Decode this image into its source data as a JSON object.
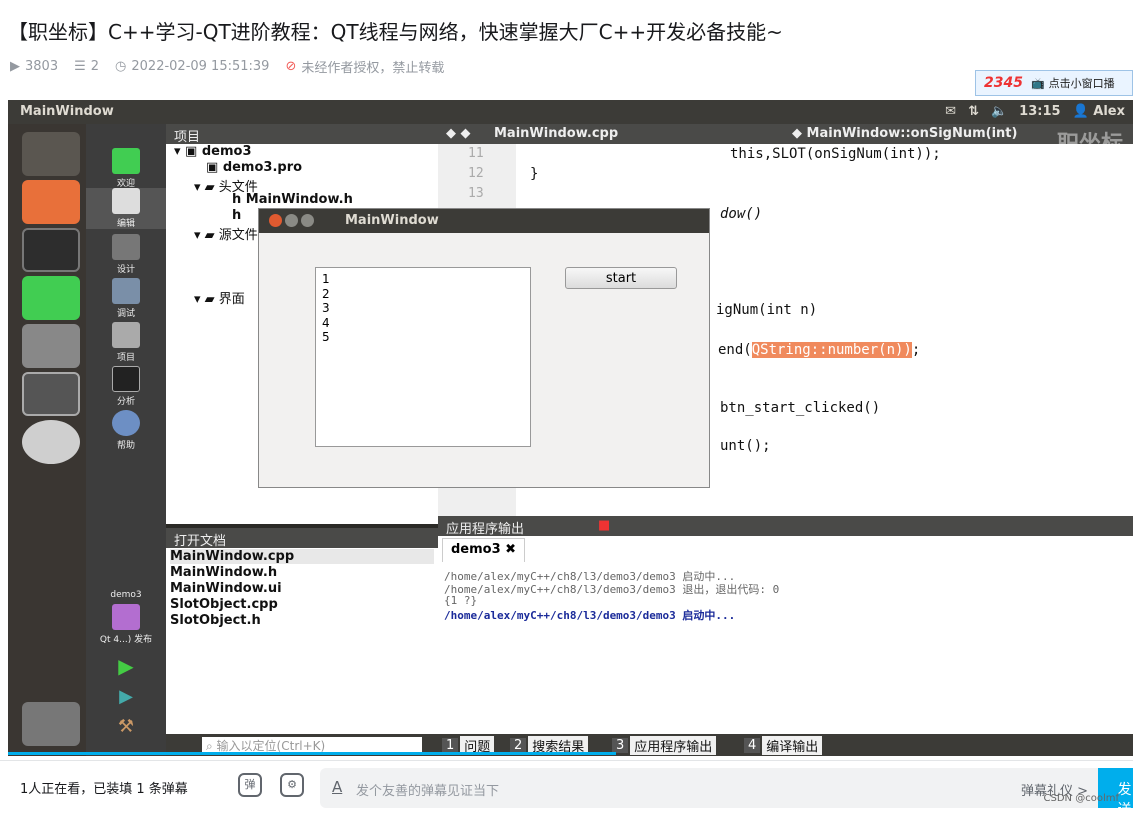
{
  "video": {
    "title": "【职坐标】C++学习-QT进阶教程：QT线程与网络，快速掌握大厂C++开发必备技能~",
    "play_count": "3803",
    "danmaku_count": "2",
    "date": "2022-02-09 15:51:39",
    "copyright_notice": "未经作者授权，禁止转载",
    "popup_logo": "2345",
    "popup_text": "点击小窗口播"
  },
  "desktop": {
    "window_title": "MainWindow",
    "time": "13:15",
    "user": "Alex",
    "watermark": "职坐标"
  },
  "qtcreator": {
    "modes": [
      "欢迎",
      "编辑",
      "设计",
      "调试",
      "项目",
      "分析",
      "帮助"
    ],
    "kit_project": "demo3",
    "kit_label": "Qt 4...) 发布",
    "project_panel_title": "项目",
    "tree": {
      "root": "demo3",
      "pro": "demo3.pro",
      "headers": "头文件",
      "header_file": "MainWindow.h",
      "sources": "源文件",
      "forms": "界面"
    },
    "open_docs_title": "打开文档",
    "open_docs": [
      "MainWindow.cpp",
      "MainWindow.h",
      "MainWindow.ui",
      "SlotObject.cpp",
      "SlotObject.h"
    ],
    "editor_file": "MainWindow.cpp",
    "editor_symbol": "MainWindow::onSigNum(int)",
    "line_numbers": [
      "11",
      "12",
      "13"
    ],
    "code": {
      "line1": "this,SLOT(onSigNum(int));",
      "line2": "}",
      "line3": "dow()",
      "line4": "igNum(int n)",
      "line5a": "end(",
      "line5b": "QString::number(n))",
      "line5c": ";",
      "line6": "btn_start_clicked()",
      "line7": "unt();"
    },
    "output_title": "应用程序输出",
    "output_tab": "demo3",
    "output_lines": [
      "/home/alex/myC++/ch8/l3/demo3/demo3 启动中...",
      "/home/alex/myC++/ch8/l3/demo3/demo3 退出，退出代码: 0",
      "{1 ?}",
      "/home/alex/myC++/ch8/l3/demo3/demo3 启动中..."
    ],
    "locator_placeholder": "输入以定位(Ctrl+K)",
    "status_tabs": [
      {
        "n": "1",
        "label": "问题"
      },
      {
        "n": "2",
        "label": "搜索结果"
      },
      {
        "n": "3",
        "label": "应用程序输出"
      },
      {
        "n": "4",
        "label": "编译输出"
      }
    ]
  },
  "dialog": {
    "title": "MainWindow",
    "list_items": [
      "1",
      "2",
      "3",
      "4",
      "5"
    ],
    "start_label": "start"
  },
  "player": {
    "progress": 0.54,
    "viewers_text": "1人正在看，已装填 1 条弹幕",
    "danmaku_placeholder": "发个友善的弹幕见证当下",
    "etiquette": "弹幕礼仪 >",
    "send_label": "发送",
    "credit": "CSDN @coolmf"
  }
}
